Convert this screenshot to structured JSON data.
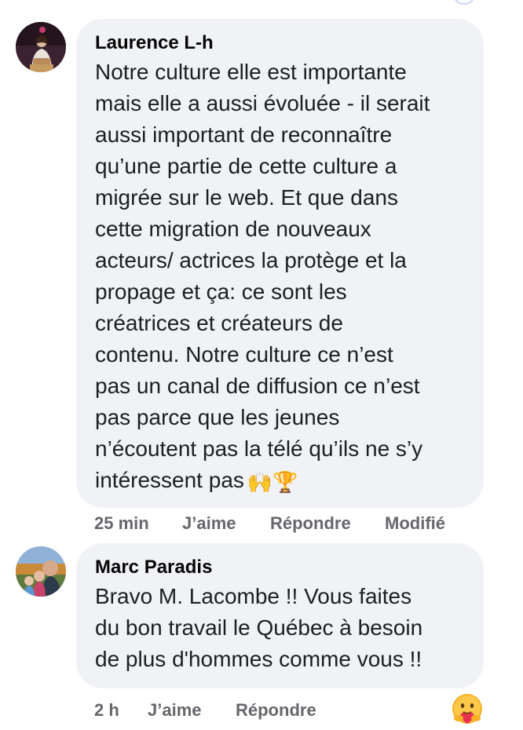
{
  "comments": [
    {
      "author": "Laurence L-h",
      "text_lines": [
        "Notre culture elle est importante",
        "mais elle a aussi évoluée - il serait",
        "aussi important de reconnaître",
        "qu’une partie de cette culture a",
        "migrée sur le web. Et que dans",
        "cette migration de nouveaux",
        "acteurs/ actrices la protège et la",
        "propage et ça: ce sont les",
        "créatrices et créateurs de",
        "contenu. Notre culture ce n’est",
        "pas un canal de diffusion ce n’est",
        "pas parce que les jeunes",
        "n’écoutent pas la télé qu’ils ne s’y",
        "intéressent pas"
      ],
      "emojis": "🙌🏆",
      "time": "25 min",
      "like_label": "J’aime",
      "reply_label": "Répondre",
      "edited_label": "Modifié"
    },
    {
      "author": "Marc Paradis",
      "text_lines": [
        "Bravo M. Lacombe !! Vous faites",
        "du bon travail le Québec à besoin",
        "de plus d'hommes comme vous !!"
      ],
      "time": "2 h",
      "like_label": "J’aime",
      "reply_label": "Répondre",
      "reaction_icon": "care-reaction-icon"
    }
  ]
}
